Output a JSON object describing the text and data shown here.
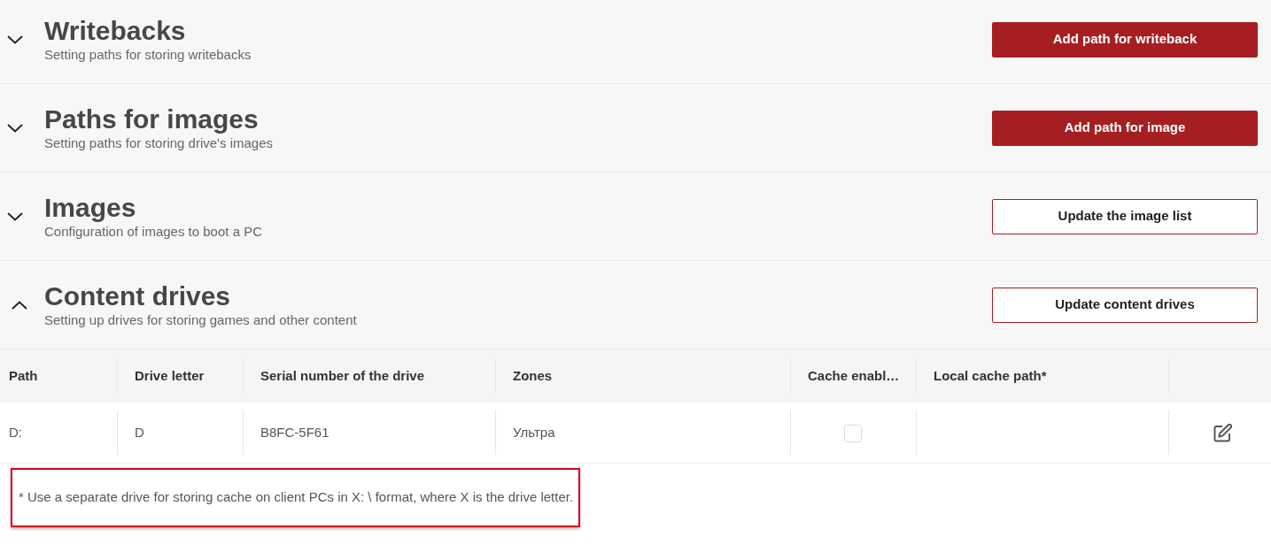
{
  "sections": [
    {
      "title": "Writebacks",
      "subtitle": "Setting paths for storing writebacks",
      "expanded": false,
      "button": {
        "label": "Add path for writeback",
        "kind": "primary"
      }
    },
    {
      "title": "Paths for images",
      "subtitle": "Setting paths for storing drive's images",
      "expanded": false,
      "button": {
        "label": "Add path for image",
        "kind": "primary"
      }
    },
    {
      "title": "Images",
      "subtitle": "Configuration of images to boot a PC",
      "expanded": false,
      "button": {
        "label": "Update the image list",
        "kind": "outline"
      }
    },
    {
      "title": "Content drives",
      "subtitle": "Setting up drives for storing games and other content",
      "expanded": true,
      "button": {
        "label": "Update content drives",
        "kind": "outline"
      },
      "table": {
        "columns": [
          "Path",
          "Drive letter",
          "Serial number of the drive",
          "Zones",
          "Cache enabl…",
          "Local cache path*"
        ],
        "rows": [
          {
            "cells": [
              "D:",
              "D",
              "B8FC-5F61",
              "Ультра"
            ],
            "cache_enabled": false
          }
        ]
      },
      "note": "* Use a separate drive for storing cache on client PCs in X: \\ format, where X is the drive letter."
    }
  ]
}
